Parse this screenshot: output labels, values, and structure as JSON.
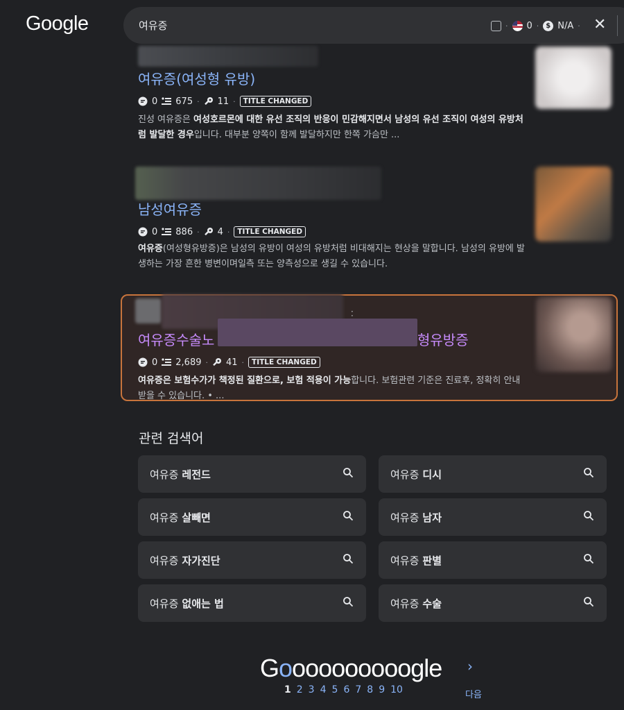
{
  "header": {
    "logo": "Google",
    "query": "여유증",
    "tools": {
      "flag_count": "0",
      "dollar_text": "N/A"
    }
  },
  "results": [
    {
      "title": "여유증(여성형 유방)",
      "comments": "0",
      "words": "675",
      "keywords": "11",
      "badge": "TITLE CHANGED",
      "snippet_parts": [
        "진성 여유증은 ",
        "여성호르몬에 대한 유선 조직의 반응이 민감해지면서 남성의 유선 조직이 여성의 유방처럼 발달한 경우",
        "입니다. 대부분 양쪽이 함께 발달하지만 한쪽 가슴만 ..."
      ]
    },
    {
      "title": "남성여유증",
      "comments": "0",
      "words": "886",
      "keywords": "4",
      "badge": "TITLE CHANGED",
      "snippet_parts": [
        "여유증",
        "(여성형유방증)은 남성의 유방이 여성의 유방처럼 비대해지는 현상을 말합니다. 남성의 유방에 발생하는 가장 흔한 병변이며일측 또는 양측성으로 생길 수 있습니다."
      ]
    },
    {
      "title_left": "여유증수술노",
      "title_right": "형유방증",
      "comments": "0",
      "words": "2,689",
      "keywords": "41",
      "badge": "TITLE CHANGED",
      "snippet_parts": [
        "여유증은 보험수가가 책정된 질환으로, 보험 적용이 가능",
        "합니다. 보험관련 기준은 진료후, 정확히 안내 받을 수 있습니다. • ..."
      ]
    }
  ],
  "related": {
    "title": "관련 검색어",
    "prefix": "여유증",
    "items": [
      "레전드",
      "디시",
      "살빼면",
      "남자",
      "자가진단",
      "판별",
      "없애는 법",
      "수술"
    ]
  },
  "pagination": {
    "logo_o_count": "ooooooooo",
    "pages": [
      "1",
      "2",
      "3",
      "4",
      "5",
      "6",
      "7",
      "8",
      "9",
      "10"
    ],
    "next_label": "다음"
  },
  "colors": {
    "link": "#8ab4f8",
    "visited": "#c58af9",
    "highlight_border": "#c8743c"
  }
}
